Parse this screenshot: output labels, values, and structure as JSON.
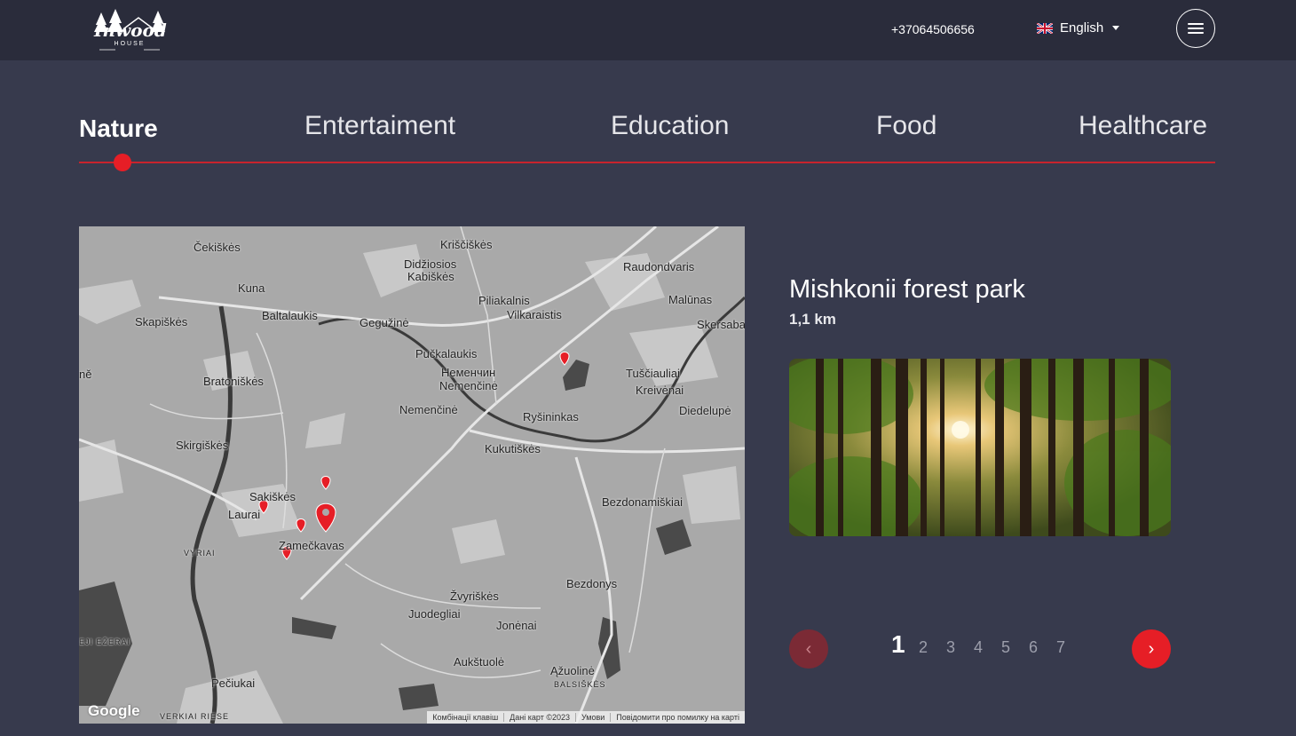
{
  "header": {
    "logo_text": "Inwood",
    "logo_sub": "HOUSE",
    "phone": "+37064506656",
    "language": "English"
  },
  "tabs": [
    {
      "label": "Nature",
      "active": true
    },
    {
      "label": "Entertaiment",
      "active": false
    },
    {
      "label": "Education",
      "active": false
    },
    {
      "label": "Food",
      "active": false
    },
    {
      "label": "Healthcare",
      "active": false
    }
  ],
  "map": {
    "labels": [
      "Čekiškės",
      "Kriščiškės",
      "Didžiosios",
      "Kabiškės",
      "Raudondvaris",
      "Kuna",
      "Piliakalnis",
      "Malūnas",
      "Skapiškės",
      "Baltalaukis",
      "Gegužinė",
      "Vilkaraistis",
      "Skersaba",
      "Pučkalaukis",
      "Неменчин",
      "Nemenčinė",
      "Tuščiauliai",
      "Bratoniškės",
      "Kreivėnai",
      "Nemenčinė",
      "Ryšininkas",
      "Diedelupė",
      "Skirgiškės",
      "Kukutiškės",
      "Sakiškės",
      "Laurai",
      "Bezdonamiškiai",
      "Zamečkavas",
      "Bezdonys",
      "Žvyriškės",
      "Juodegliai",
      "Jonėnai",
      "Aukštuolė",
      "Ąžuolinė",
      "Pečiukai",
      "VYRIAI",
      "BALSIŠKĖS",
      "VERKIAI RIESE",
      "EJI EŽERAI",
      "ně"
    ],
    "google": "Google",
    "footer": [
      "Комбінації клавіш",
      "Дані карт ©2023",
      "Умови",
      "Повідомити про помилку на карті"
    ]
  },
  "place": {
    "title": "Mishkonii forest park",
    "distance": "1,1 km"
  },
  "pager": {
    "prev": "‹",
    "next": "›",
    "pages": [
      "1",
      "2",
      "3",
      "4",
      "5",
      "6",
      "7"
    ],
    "current": "1"
  },
  "colors": {
    "accent": "#e61e26",
    "background": "#373a4d",
    "header": "#2a2c3b"
  }
}
